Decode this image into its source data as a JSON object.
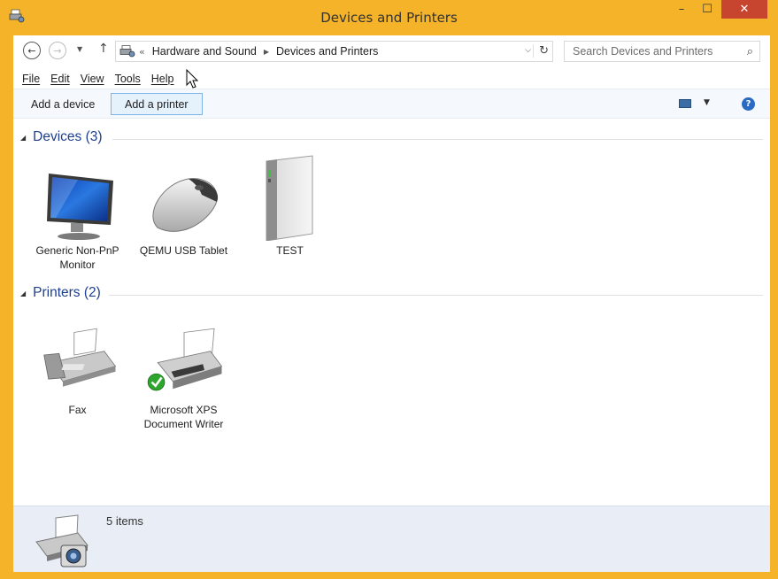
{
  "window": {
    "title": "Devices and Printers",
    "minimize": "–",
    "maximize": "☐",
    "close": "✕"
  },
  "address": {
    "crumbs": [
      "Hardware and Sound",
      "Devices and Printers"
    ],
    "search_placeholder": "Search Devices and Printers"
  },
  "menu": {
    "items": [
      "File",
      "Edit",
      "View",
      "Tools",
      "Help"
    ]
  },
  "commands": {
    "add_device": "Add a device",
    "add_printer": "Add a printer"
  },
  "groups": {
    "devices": {
      "label": "Devices (3)",
      "items": [
        {
          "label": "Generic Non-PnP Monitor",
          "icon": "monitor-icon"
        },
        {
          "label": "QEMU USB Tablet",
          "icon": "mouse-icon"
        },
        {
          "label": "TEST",
          "icon": "computer-tower-icon"
        }
      ]
    },
    "printers": {
      "label": "Printers (2)",
      "items": [
        {
          "label": "Fax",
          "icon": "fax-icon"
        },
        {
          "label": "Microsoft XPS Document Writer",
          "icon": "printer-icon",
          "default": true
        }
      ]
    }
  },
  "status": {
    "text": "5 items"
  },
  "colors": {
    "frame": "#f4b328",
    "close": "#c7452f",
    "group_label": "#1e3f8d",
    "status_bg": "#e9eef6"
  }
}
